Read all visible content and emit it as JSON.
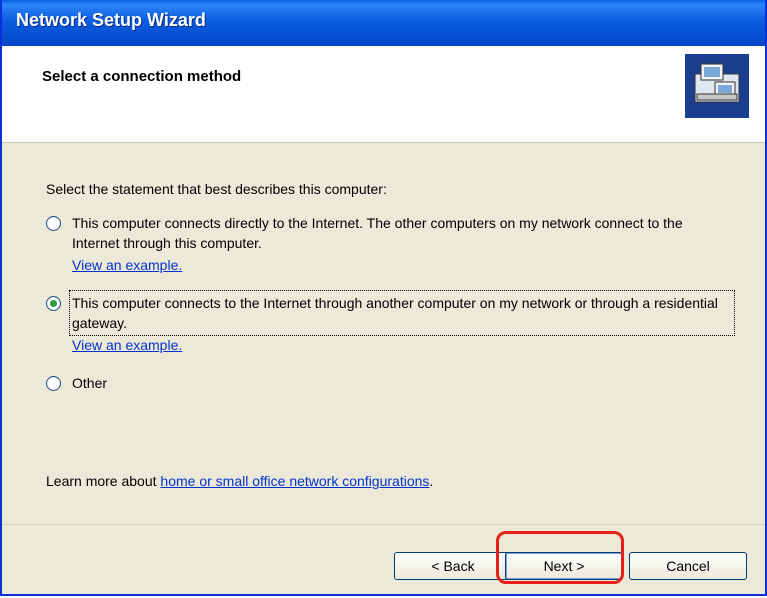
{
  "window": {
    "title": "Network Setup Wizard"
  },
  "header": {
    "title": "Select a connection method",
    "icon": "network-computers-icon"
  },
  "content": {
    "prompt": "Select the statement that best describes this computer:",
    "options": [
      {
        "label": "This computer connects directly to the Internet. The other computers on my network connect to the Internet through this computer.",
        "example_link": "View an example.",
        "checked": false
      },
      {
        "label": "This computer connects to the Internet through another computer on my network or through a residential gateway.",
        "example_link": "View an example.",
        "checked": true
      },
      {
        "label": "Other",
        "checked": false
      }
    ],
    "learn_prefix": "Learn more about",
    "learn_link": "home or small office network configurations",
    "learn_suffix": "."
  },
  "footer": {
    "back_label": "< Back",
    "next_label": "Next >",
    "cancel_label": "Cancel"
  },
  "colors": {
    "title_bar": "#0a5de0",
    "dialog_bg": "#ece9d8",
    "highlight": "#e5201a",
    "link": "#0033cc"
  }
}
